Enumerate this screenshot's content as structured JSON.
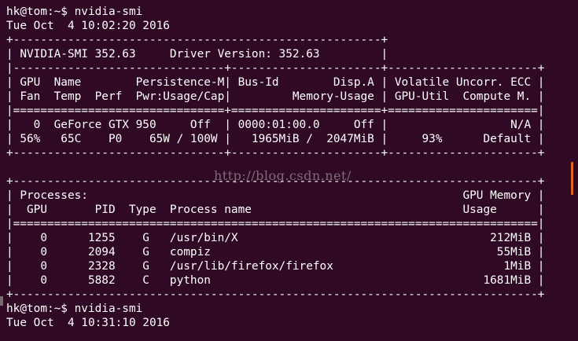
{
  "terminal": {
    "lines": [
      "hk@tom:~$ nvidia-smi",
      "Tue Oct  4 10:02:20 2016",
      "+------------------------------------------------------+",
      "| NVIDIA-SMI 352.63     Driver Version: 352.63         |",
      "|-------------------------------+----------------------+----------------------+",
      "| GPU  Name        Persistence-M| Bus-Id        Disp.A | Volatile Uncorr. ECC |",
      "| Fan  Temp  Perf  Pwr:Usage/Cap|         Memory-Usage | GPU-Util  Compute M. |",
      "|===============================+======================+======================|",
      "|   0  GeForce GTX 950     Off  | 0000:01:00.0     Off |                  N/A |",
      "| 56%   65C    P0    65W / 100W |   1965MiB /  2047MiB |     93%      Default |",
      "+-------------------------------+----------------------+----------------------+",
      "",
      "+-----------------------------------------------------------------------------+",
      "| Processes:                                                       GPU Memory |",
      "|  GPU       PID  Type  Process name                               Usage      |",
      "|=============================================================================|",
      "|    0      1255    G   /usr/bin/X                                     212MiB |",
      "|    0      2094    G   compiz                                          55MiB |",
      "|    0      2328    G   /usr/lib/firefox/firefox                         1MiB |",
      "|    0      5882    C   python                                        1681MiB |",
      "+-----------------------------------------------------------------------------+",
      "hk@tom:~$ nvidia-smi",
      "Tue Oct  4 10:31:10 2016"
    ]
  },
  "watermark": "http://blog.csdn.net/",
  "colors": {
    "background": "#300a24",
    "text": "#ffffff",
    "scrollbar": "#e2651f"
  }
}
